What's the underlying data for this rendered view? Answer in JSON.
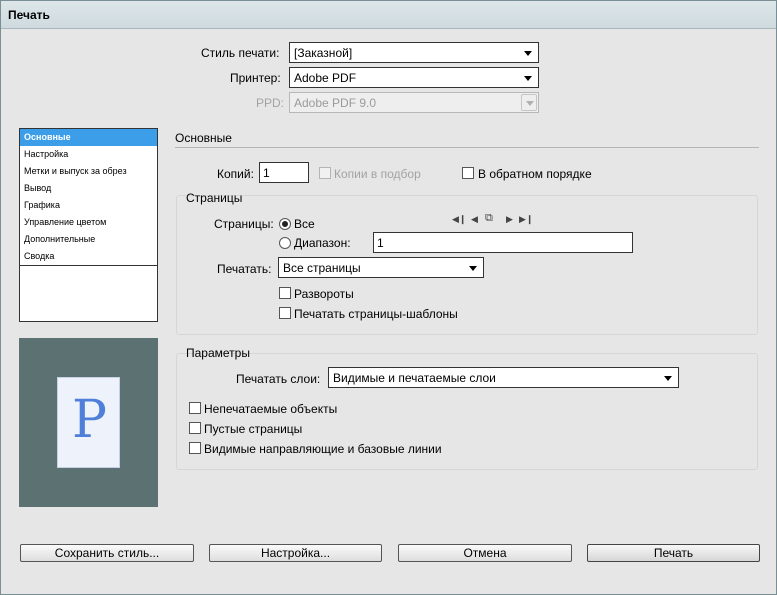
{
  "window": {
    "title": "Печать"
  },
  "top": {
    "style_label": "Стиль печати:",
    "style_value": "[Заказной]",
    "printer_label": "Принтер:",
    "printer_value": "Adobe PDF",
    "ppd_label": "PPD:",
    "ppd_value": "Adobe PDF 9.0"
  },
  "sidebar": {
    "items": [
      {
        "label": "Основные",
        "selected": true
      },
      {
        "label": "Настройка"
      },
      {
        "label": "Метки и выпуск за обрез"
      },
      {
        "label": "Вывод"
      },
      {
        "label": "Графика"
      },
      {
        "label": "Управление цветом"
      },
      {
        "label": "Дополнительные"
      },
      {
        "label": "Сводка"
      }
    ]
  },
  "preview": {
    "letter": "P"
  },
  "main": {
    "section_title": "Основные",
    "copies_label": "Копий:",
    "copies_value": "1",
    "collate_label": "Копии в подбор",
    "reverse_label": "В обратном порядке",
    "pages_group": {
      "title": "Страницы",
      "pages_label": "Страницы:",
      "all_label": "Все",
      "range_label": "Диапазон:",
      "range_value": "1",
      "print_label": "Печатать:",
      "print_value": "Все страницы",
      "spreads_label": "Развороты",
      "master_label": "Печатать страницы-шаблоны"
    },
    "options_group": {
      "title": "Параметры",
      "layers_label": "Печатать слои:",
      "layers_value": "Видимые и печатаемые слои",
      "nonprint_label": "Непечатаемые объекты",
      "blank_label": "Пустые страницы",
      "guides_label": "Видимые направляющие и базовые линии"
    }
  },
  "buttons": {
    "save_style": "Сохранить стиль...",
    "setup": "Настройка...",
    "cancel": "Отмена",
    "print": "Печать"
  },
  "nav_icons": [
    "first-page-icon",
    "prev-page-icon",
    "page-select-icon",
    "next-page-icon",
    "last-page-icon"
  ]
}
